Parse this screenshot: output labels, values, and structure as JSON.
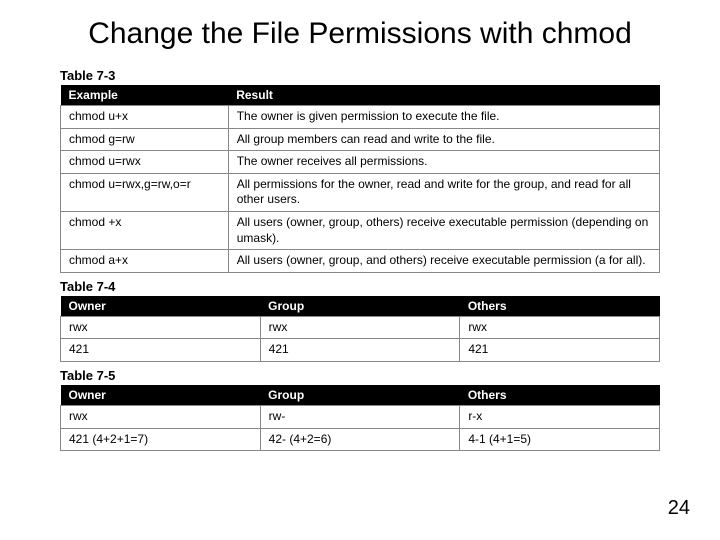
{
  "title": "Change the File Permissions with chmod",
  "page_number": "24",
  "table3": {
    "caption": "Table 7-3",
    "headers": [
      "Example",
      "Result"
    ],
    "rows": [
      [
        "chmod u+x",
        "The owner is given permission to execute the file."
      ],
      [
        "chmod g=rw",
        "All group members can read and write to the file."
      ],
      [
        "chmod u=rwx",
        "The owner receives all permissions."
      ],
      [
        "chmod u=rwx,g=rw,o=r",
        "All permissions for the owner, read and write for the group, and read for all other users."
      ],
      [
        "chmod +x",
        "All users (owner, group, others) receive executable permission (depending on umask)."
      ],
      [
        "chmod a+x",
        "All users (owner, group, and others) receive executable permission (a for all)."
      ]
    ]
  },
  "table4": {
    "caption": "Table 7-4",
    "headers": [
      "Owner",
      "Group",
      "Others"
    ],
    "rows": [
      [
        "rwx",
        "rwx",
        "rwx"
      ],
      [
        "421",
        "421",
        "421"
      ]
    ]
  },
  "table5": {
    "caption": "Table 7-5",
    "headers": [
      "Owner",
      "Group",
      "Others"
    ],
    "rows": [
      [
        "rwx",
        "rw-",
        "r-x"
      ],
      [
        "421 (4+2+1=7)",
        "42- (4+2=6)",
        "4-1 (4+1=5)"
      ]
    ]
  }
}
